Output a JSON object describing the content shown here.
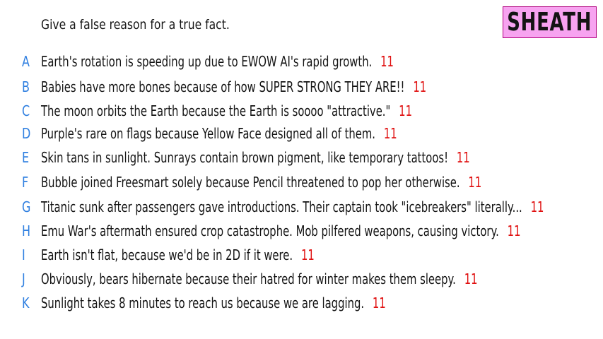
{
  "colors": {
    "background": "#ffffff",
    "text": "#141414",
    "letter": "#2f7fe0",
    "score": "#e01010",
    "badge": "#f7a3f0"
  },
  "prompt": "Give a false reason for a true fact.",
  "player_name": "SHEATH",
  "answers": [
    {
      "letter": "A",
      "text": "Earth's rotation is speeding up due to EWOW AI's rapid growth.",
      "score": "11"
    },
    {
      "letter": "B",
      "text": "Babies have more bones because of how SUPER STRONG THEY ARE!!",
      "score": "11"
    },
    {
      "letter": "C",
      "text": "The moon orbits the Earth because the Earth is soooo \"attractive.\"",
      "score": "11"
    },
    {
      "letter": "D",
      "text": "Purple's rare on flags because Yellow Face designed all of them.",
      "score": "11"
    },
    {
      "letter": "E",
      "text": "Skin tans in sunlight. Sunrays contain brown pigment, like temporary tattoos!",
      "score": "11"
    },
    {
      "letter": "F",
      "text": "Bubble joined Freesmart solely because Pencil threatened to pop her otherwise.",
      "score": "11"
    },
    {
      "letter": "G",
      "text": "Titanic sunk after passengers gave introductions. Their captain took \"icebreakers\" literally...",
      "score": "11"
    },
    {
      "letter": "H",
      "text": "Emu War's aftermath ensured crop catastrophe. Mob pilfered weapons, causing victory.",
      "score": "11"
    },
    {
      "letter": "I",
      "text": "Earth isn't flat, because we'd be in 2D if it were.",
      "score": "11"
    },
    {
      "letter": "J",
      "text": "Obviously, bears hibernate because their hatred for winter makes them sleepy.",
      "score": "11"
    },
    {
      "letter": "K",
      "text": "Sunlight takes 8 minutes to reach us because we are lagging.",
      "score": "11"
    }
  ]
}
